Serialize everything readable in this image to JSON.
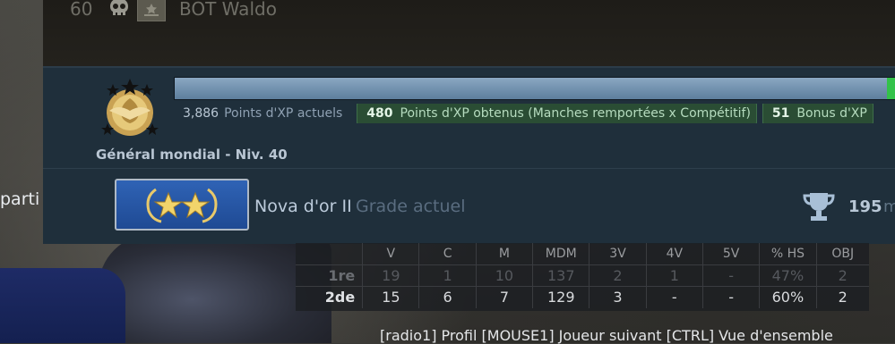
{
  "top_player": {
    "ping": "60",
    "name": "BOT Waldo"
  },
  "profile": {
    "level_label": "Général mondial - Niv. 40",
    "xp_progress": 0.99,
    "current_xp": {
      "value": "3,886",
      "label": "Points d'XP actuels"
    },
    "earned_xp": {
      "value": "480",
      "label": "Points d'XP obtenus (Manches remportées x Compétitif)"
    },
    "bonus_xp": {
      "value": "51",
      "label": "Bonus d'XP"
    },
    "rank_name": "Nova d'or II",
    "rank_sub": "Grade actuel",
    "wins": "195",
    "wins_unit": "m",
    "edge_text": "parti"
  },
  "stats": {
    "headers": [
      "V",
      "C",
      "M",
      "MDM",
      "3V",
      "4V",
      "5V",
      "% HS",
      "OBJ"
    ],
    "rows": [
      {
        "label": "1re",
        "values": [
          "19",
          "1",
          "10",
          "137",
          "2",
          "1",
          "-",
          "47%",
          "2"
        ]
      },
      {
        "label": "2de",
        "values": [
          "15",
          "6",
          "7",
          "129",
          "3",
          "-",
          "-",
          "60%",
          "2"
        ]
      }
    ]
  },
  "hint": "[radio1] Profil [MOUSE1] Joueur suivant [CTRL] Vue d'ensemble",
  "colors": {
    "panel": "#1f2f3b",
    "xp_fill": "#6e8fae",
    "xp_green": "#33c24a",
    "chip_green": "#2a4d34",
    "rank_blue": "#2557a5"
  }
}
